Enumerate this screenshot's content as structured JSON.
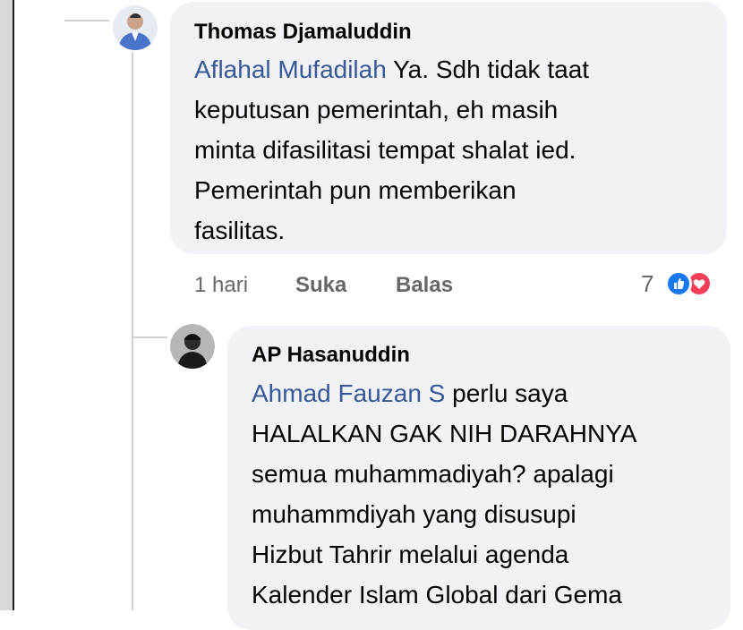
{
  "comments": [
    {
      "author": "Thomas Djamaluddin",
      "mention": "Aflahal Mufadilah",
      "lines": [
        " Ya. Sdh tidak taat",
        "keputusan pemerintah, eh masih",
        "minta difasilitasi tempat shalat ied.",
        "Pemerintah pun memberikan",
        "fasilitas."
      ],
      "meta": {
        "time": "1 hari",
        "like": "Suka",
        "reply": "Balas"
      },
      "reaction_count": "7",
      "reactions": [
        "like-icon",
        "love-icon"
      ],
      "colors": {
        "like": "#1877f2",
        "love": "#f33e58"
      }
    },
    {
      "author": "AP Hasanuddin",
      "mention": "Ahmad Fauzan S",
      "lines": [
        " perlu saya",
        "HALALKAN GAK NIH DARAHNYA",
        "semua muhammadiyah? apalagi",
        "muhammdiyah yang disusupi",
        "Hizbut Tahrir melalui agenda",
        "Kalender Islam Global dari Gema"
      ]
    }
  ]
}
